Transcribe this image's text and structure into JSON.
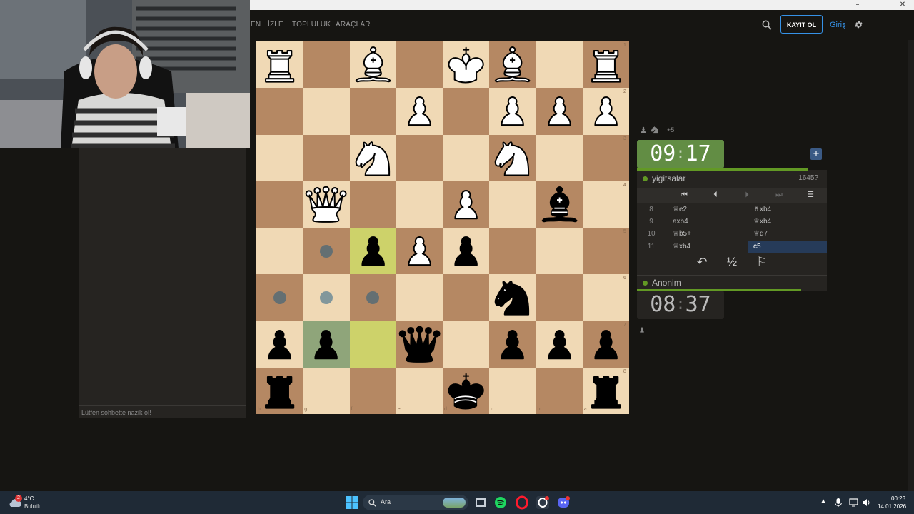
{
  "window": {
    "minimize": "–",
    "maximize": "❐",
    "close": "✕"
  },
  "nav": {
    "items": [
      "EN",
      "İZLE",
      "TOPLULUK",
      "ARAÇLAR"
    ],
    "register_label": "KAYIT OL",
    "login_label": "Giriş"
  },
  "chat": {
    "placeholder": "Lütfen sohbette nazik ol!"
  },
  "board": {
    "rank_labels": [
      "1",
      "2",
      "3",
      "4",
      "5",
      "6",
      "7",
      "8"
    ],
    "file_labels": [
      "h",
      "g",
      "f",
      "e",
      "d",
      "c",
      "b",
      "a"
    ],
    "pieces": [
      {
        "sq": "a1",
        "p": "wR"
      },
      {
        "sq": "c1",
        "p": "wB"
      },
      {
        "sq": "d1",
        "p": "wK"
      },
      {
        "sq": "f1",
        "p": "wB"
      },
      {
        "sq": "h1",
        "p": "wR"
      },
      {
        "sq": "a2",
        "p": "wP"
      },
      {
        "sq": "b2",
        "p": "wP"
      },
      {
        "sq": "c2",
        "p": "wP"
      },
      {
        "sq": "e2",
        "p": "wP"
      },
      {
        "sq": "c3",
        "p": "wN"
      },
      {
        "sq": "f3",
        "p": "wN"
      },
      {
        "sq": "b4",
        "p": "bB"
      },
      {
        "sq": "d4",
        "p": "wP"
      },
      {
        "sq": "g4",
        "p": "wQ"
      },
      {
        "sq": "d5",
        "p": "bP"
      },
      {
        "sq": "e5",
        "p": "wP"
      },
      {
        "sq": "f5",
        "p": "bP"
      },
      {
        "sq": "c6",
        "p": "bN"
      },
      {
        "sq": "a7",
        "p": "bP"
      },
      {
        "sq": "b7",
        "p": "bP"
      },
      {
        "sq": "c7",
        "p": "bP"
      },
      {
        "sq": "e7",
        "p": "bQ"
      },
      {
        "sq": "g7",
        "p": "bP"
      },
      {
        "sq": "h7",
        "p": "bP"
      },
      {
        "sq": "a8",
        "p": "bR"
      },
      {
        "sq": "d8",
        "p": "bK"
      },
      {
        "sq": "h8",
        "p": "bR"
      }
    ],
    "last_move": [
      "f5",
      "f7"
    ],
    "selected": "g7",
    "move_dots": [
      "g5",
      "f6",
      "g6",
      "h6"
    ]
  },
  "top_player": {
    "name": "yigitsalar",
    "rating": "1645?",
    "clock_min": "09",
    "clock_sec": "17",
    "material": "+5"
  },
  "bottom_player": {
    "name": "Anonim",
    "clock_min": "08",
    "clock_sec": "37"
  },
  "moves": [
    {
      "num": "8",
      "white": "♕e2",
      "black": "♗xb4"
    },
    {
      "num": "9",
      "white": "axb4",
      "black": "♕xb4"
    },
    {
      "num": "10",
      "white": "♕b5+",
      "black": "♕d7"
    },
    {
      "num": "11",
      "white": "♕xb4",
      "black": "c5"
    }
  ],
  "move_nav": {
    "first": "⏮",
    "prev": "⏴",
    "next": "⏵",
    "last": "⏭",
    "menu": "☰"
  },
  "game_actions": {
    "takeback": "↶",
    "draw": "½",
    "resign": "⚐"
  },
  "taskbar": {
    "weather_temp": "4°C",
    "weather_desc": "Bulutlu",
    "weather_badge": "2",
    "search_label": "Ara",
    "time": "00:23",
    "date": "14.01.2026"
  },
  "colors": {
    "accent": "#3692e7",
    "clock_active": "#628d44",
    "highlight": "#cdd26a"
  }
}
